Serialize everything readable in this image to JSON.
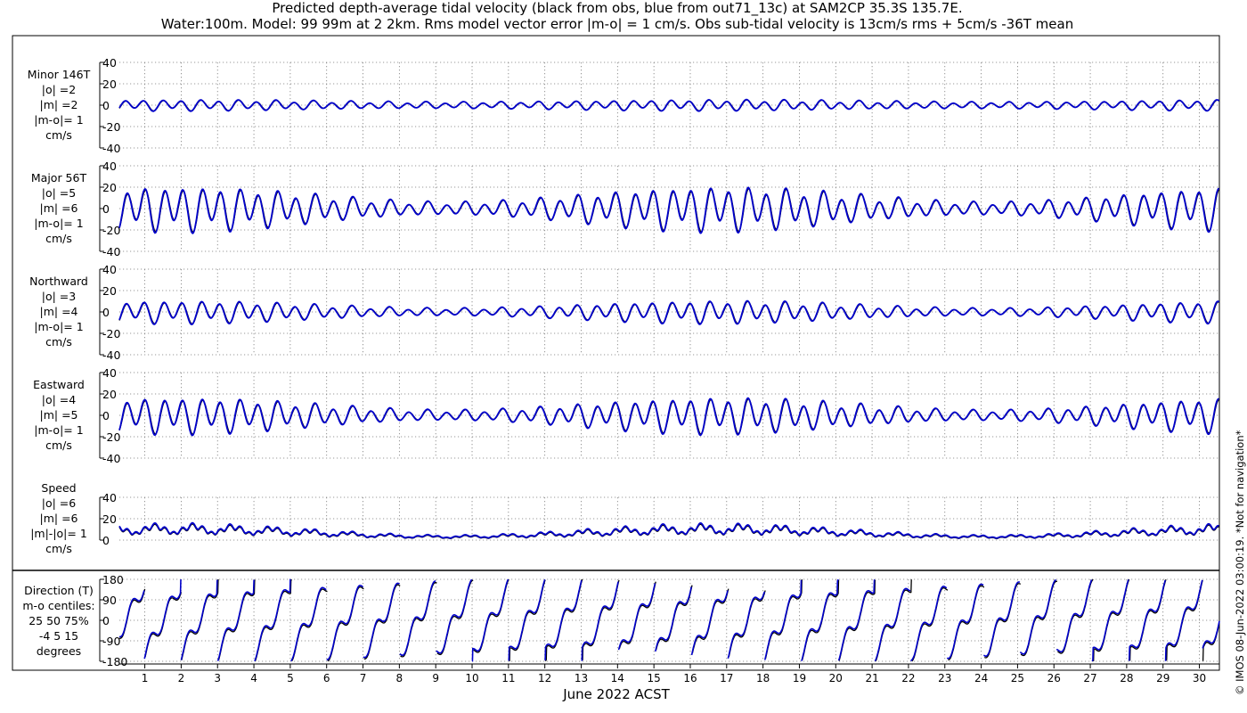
{
  "title_line1": "Predicted depth-average tidal velocity (black from obs, blue from out71_13c) at SAM2CP 35.3S 135.7E.",
  "title_line2": "Water:100m. Model: 99 99m at 2 2km. Rms model vector error |m-o| = 1 cm/s. Obs sub-tidal velocity is 13cm/s rms + 5cm/s -36T mean",
  "side_note": "© IMOS 08-Jun-2022 03:00:19. *Not for navigation*",
  "chart_data": {
    "type": "line",
    "xlabel": "June 2022 ACST",
    "x_ticks": [
      "1",
      "2",
      "3",
      "4",
      "5",
      "6",
      "7",
      "8",
      "9",
      "10",
      "11",
      "12",
      "13",
      "14",
      "15",
      "16",
      "17",
      "18",
      "19",
      "20",
      "21",
      "22",
      "23",
      "24",
      "25",
      "26",
      "27",
      "28",
      "29",
      "30"
    ],
    "xlim_days": [
      0.3,
      30.55
    ],
    "series_names": [
      "obs",
      "out71_13c"
    ],
    "colors": {
      "obs": "#000000",
      "model": "#0000cc",
      "grid": "#7a7a7a"
    },
    "panels": [
      {
        "id": "minor",
        "labels": [
          "Minor 146T",
          "|o| =2",
          "|m| =2",
          "|m-o|= 1",
          "cm/s"
        ],
        "yticks": [
          "40",
          "20",
          "0",
          "-20",
          "-40"
        ],
        "ylim": [
          -40,
          40
        ],
        "kind": "component",
        "amp": 3.2,
        "phase": 0.6,
        "spring": 0.25
      },
      {
        "id": "major",
        "labels": [
          "Major 56T",
          "|o| =5",
          "|m| =6",
          "|m-o|= 1",
          "cm/s"
        ],
        "yticks": [
          "40",
          "20",
          "0",
          "-20",
          "-40"
        ],
        "ylim": [
          -40,
          40
        ],
        "kind": "component",
        "amp": 10.5,
        "phase": 0.0,
        "spring": 0.55
      },
      {
        "id": "north",
        "labels": [
          "Northward",
          "|o| =3",
          "|m| =4",
          "|m-o|= 1",
          "cm/s"
        ],
        "yticks": [
          "40",
          "20",
          "0",
          "-20",
          "-40"
        ],
        "ylim": [
          -40,
          40
        ],
        "kind": "component",
        "amp": 5.5,
        "phase": 0.3,
        "spring": 0.5
      },
      {
        "id": "east",
        "labels": [
          "Eastward",
          "|o| =4",
          "|m| =5",
          "|m-o|= 1",
          "cm/s"
        ],
        "yticks": [
          "40",
          "20",
          "0",
          "-20",
          "-40"
        ],
        "ylim": [
          -40,
          40
        ],
        "kind": "component",
        "amp": 8.5,
        "phase": 0.1,
        "spring": 0.55
      },
      {
        "id": "speed",
        "labels": [
          "Speed",
          "|o| =6",
          "|m| =6",
          "|m|-|o|= 1",
          "cm/s"
        ],
        "yticks": [
          "40",
          "20",
          "0"
        ],
        "ylim": [
          0,
          40
        ],
        "kind": "speed",
        "amp": 10.0,
        "phase": 0.0,
        "spring": 0.55
      },
      {
        "id": "direction",
        "labels": [
          "Direction (T)",
          "m-o centiles:",
          "25  50  75%",
          "-4   5  15",
          "degrees"
        ],
        "yticks": [
          "180",
          "90",
          "0",
          "-90",
          "-180"
        ],
        "ylim": [
          -180,
          180
        ],
        "kind": "direction"
      }
    ]
  }
}
